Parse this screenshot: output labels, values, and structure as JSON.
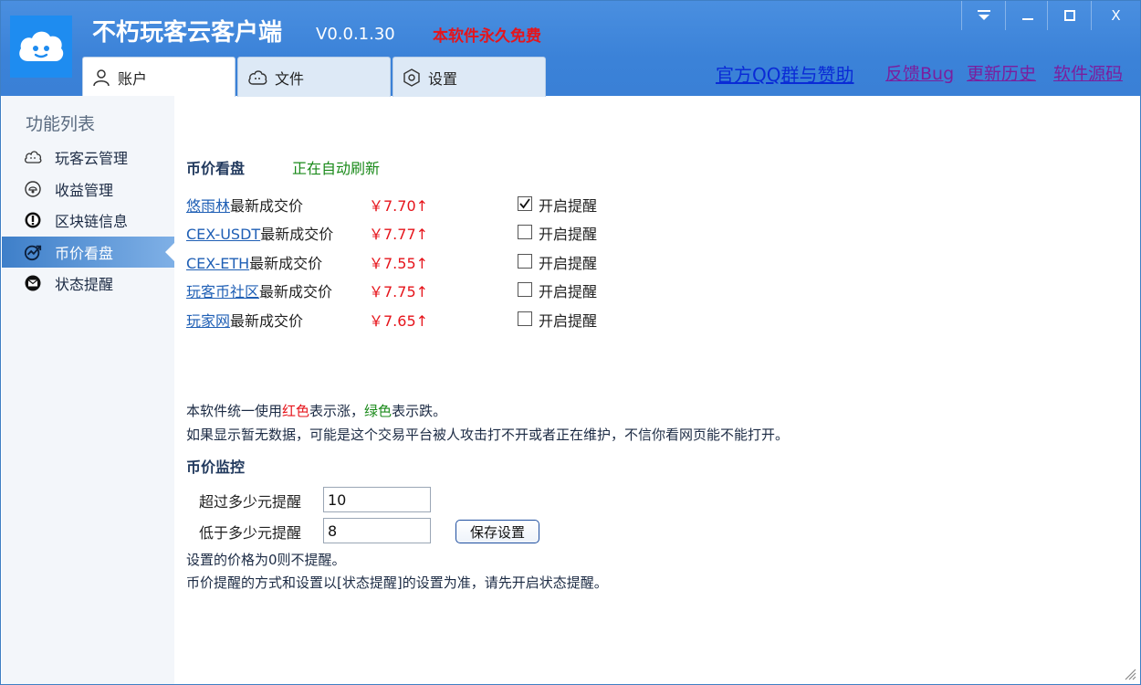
{
  "app": {
    "title": "不朽玩客云客户端",
    "version": "V0.0.1.30",
    "free_note": "本软件永久免费",
    "window_buttons": {
      "menu": "▼",
      "minimize": "—",
      "maximize": "□",
      "close": "X"
    }
  },
  "tabs": [
    {
      "label": "账户",
      "icon": "user-icon"
    },
    {
      "label": "文件",
      "icon": "cloud-icon"
    },
    {
      "label": "设置",
      "icon": "hexagon-settings-icon"
    }
  ],
  "top_links": {
    "qq_group": "官方QQ群与赞助",
    "feedback": "反馈Bug",
    "history": "更新历史",
    "source": "软件源码"
  },
  "sidebar": {
    "title": "功能列表",
    "items": [
      {
        "label": "玩客云管理",
        "icon": "cloud-outline-icon"
      },
      {
        "label": "收益管理",
        "icon": "income-icon"
      },
      {
        "label": "区块链信息",
        "icon": "alert-icon"
      },
      {
        "label": "币价看盘",
        "icon": "chart-icon"
      },
      {
        "label": "状态提醒",
        "icon": "mail-icon"
      }
    ]
  },
  "price_board": {
    "title": "币价看盘",
    "status": "正在自动刷新",
    "suffix": "最新成交价",
    "reminder_label": "开启提醒",
    "rows": [
      {
        "source": "悠雨林",
        "price": "￥7.70↑",
        "reminder_on": true
      },
      {
        "source": "CEX-USDT",
        "price": "￥7.77↑",
        "reminder_on": false
      },
      {
        "source": "CEX-ETH",
        "price": "￥7.55↑",
        "reminder_on": false
      },
      {
        "source": "玩客币社区",
        "price": "￥7.75↑",
        "reminder_on": false
      },
      {
        "source": "玩家网",
        "price": "￥7.65↑",
        "reminder_on": false
      }
    ]
  },
  "notes": {
    "line1_a": "本软件统一使用",
    "line1_red": "红色",
    "line1_b": "表示涨，",
    "line1_green": "绿色",
    "line1_c": "表示跌。",
    "line2": "如果显示暂无数据，可能是这个交易平台被人攻击打不开或者正在维护，不信你看网页能不能打开。"
  },
  "monitor": {
    "title": "币价监控",
    "above_label": "超过多少元提醒",
    "above_value": "10",
    "below_label": "低于多少元提醒",
    "below_value": "8",
    "save_label": "保存设置",
    "hint1": "设置的价格为0则不提醒。",
    "hint2": "币价提醒的方式和设置以[状态提醒]的设置为准，请先开启状态提醒。"
  },
  "colors": {
    "titlebar": "#3b82d8",
    "price_up": "#e6141b",
    "refresh_green": "#1a8a1a",
    "link_blue": "#1f5fb5",
    "sidebar_active": "#3e7fc9"
  }
}
